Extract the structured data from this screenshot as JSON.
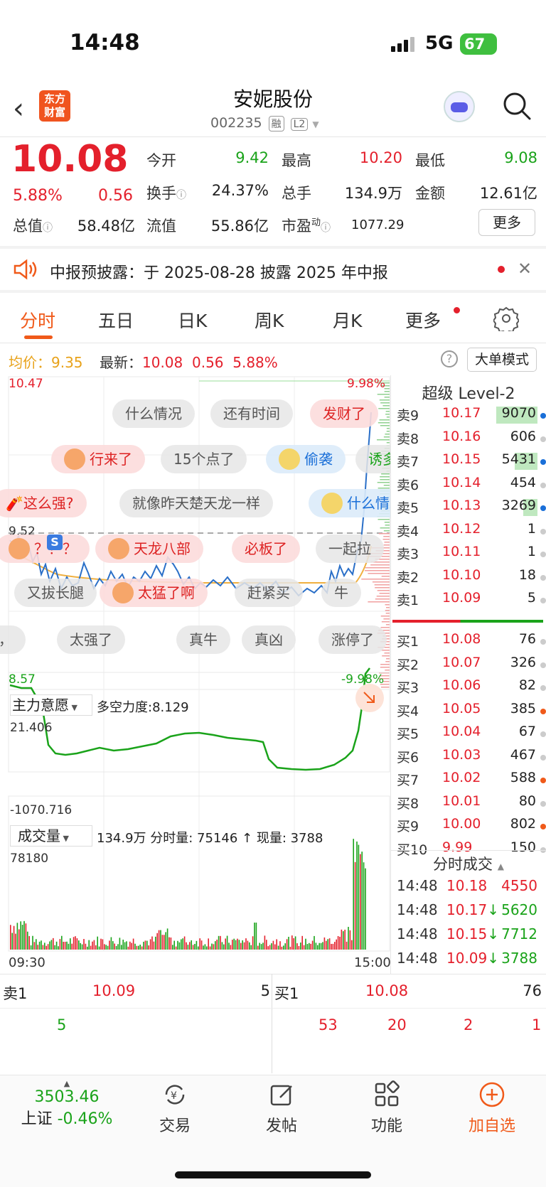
{
  "status_bar": {
    "time": "14:48",
    "network": "5G",
    "battery": "67"
  },
  "header": {
    "logo_text": "东方财富",
    "stock_name": "安妮股份",
    "stock_code": "002235",
    "tag_margin": "融",
    "tag_level": "L2"
  },
  "quote": {
    "price": "10.08",
    "change_pct": "5.88%",
    "change": "0.56",
    "open_label": "今开",
    "open": "9.42",
    "high_label": "最高",
    "high": "10.20",
    "low_label": "最低",
    "low": "9.08",
    "turnover_label": "换手",
    "turnover": "24.37%",
    "volume_label": "总手",
    "volume": "134.9万",
    "amount_label": "金额",
    "amount": "12.61亿",
    "mktcap_label": "总值",
    "mktcap": "58.48亿",
    "float_label": "流值",
    "float_cap": "55.86亿",
    "pe_label": "市盈",
    "pe_sup": "动",
    "pe": "1077.29",
    "more_label": "更多"
  },
  "notice": {
    "text": "中报预披露：于 2025-08-28 披露 2025 年中报"
  },
  "tabs": [
    "分时",
    "五日",
    "日K",
    "周K",
    "月K",
    "更多"
  ],
  "chart_info": {
    "avg_label": "均价：",
    "avg": "9.35",
    "newest_label": "最新：",
    "newest": "10.08",
    "newest_chg": "0.56",
    "newest_pct": "5.88%",
    "bigorder_label": "大单模式"
  },
  "chart_axes": {
    "y_max": "10.47",
    "y_min": "8.57",
    "pct_max": "9.98%",
    "pct_min": "-9.98%",
    "ref": "9.52",
    "t_start": "09:30",
    "t_end": "15:00",
    "main_label": "主力意愿",
    "main_metric": "多空力度:8.129",
    "main_max": "21.406",
    "main_min": "-1070.716",
    "vol_label": "成交量",
    "vol_info": "134.9万 分时量: 75146 ↑ 现量: 3788",
    "vol_max": "78180"
  },
  "danmu": [
    {
      "text": "什么情况",
      "style": "gray"
    },
    {
      "text": "还有时间",
      "style": "gray"
    },
    {
      "text": "发财了",
      "style": "pink"
    },
    {
      "text": "行来了",
      "style": "pink"
    },
    {
      "text": "15个点了",
      "style": "gray"
    },
    {
      "text": "偷袭",
      "style": "blue"
    },
    {
      "text": "诱多",
      "style": "gray"
    },
    {
      "text": "这么强?",
      "style": "pink"
    },
    {
      "text": "就像昨天楚天龙一样",
      "style": "gray"
    },
    {
      "text": "什么情况",
      "style": "blue"
    },
    {
      "text": "？？？",
      "style": "pink"
    },
    {
      "text": "天龙八部",
      "style": "pink"
    },
    {
      "text": "必板了",
      "style": "pink"
    },
    {
      "text": "一起拉",
      "style": "gray"
    },
    {
      "text": "又拔长腿",
      "style": "gray"
    },
    {
      "text": "太猛了啊",
      "style": "pink"
    },
    {
      "text": "赶紧买",
      "style": "gray"
    },
    {
      "text": "牛",
      "style": "gray"
    },
    {
      "text": "，",
      "style": "gray"
    },
    {
      "text": "太强了",
      "style": "gray"
    },
    {
      "text": "真牛",
      "style": "gray"
    },
    {
      "text": "真凶",
      "style": "gray"
    },
    {
      "text": "涨停了",
      "style": "gray"
    }
  ],
  "order_book": {
    "title": "超级 Level-2",
    "asks": [
      {
        "label": "卖9",
        "price": "10.17",
        "vol": "9070",
        "bar": 1.0,
        "dot": "#1a6fd8"
      },
      {
        "label": "卖8",
        "price": "10.16",
        "vol": "606",
        "bar": 0,
        "dot": "#ccc"
      },
      {
        "label": "卖7",
        "price": "10.15",
        "vol": "5431",
        "bar": 0.55,
        "dot": "#1a6fd8"
      },
      {
        "label": "卖6",
        "price": "10.14",
        "vol": "454",
        "bar": 0,
        "dot": "#ccc"
      },
      {
        "label": "卖5",
        "price": "10.13",
        "vol": "3269",
        "bar": 0.35,
        "dot": "#1a6fd8"
      },
      {
        "label": "卖4",
        "price": "10.12",
        "vol": "1",
        "bar": 0,
        "dot": "#ccc"
      },
      {
        "label": "卖3",
        "price": "10.11",
        "vol": "1",
        "bar": 0,
        "dot": "#ccc"
      },
      {
        "label": "卖2",
        "price": "10.10",
        "vol": "18",
        "bar": 0,
        "dot": "#ccc"
      },
      {
        "label": "卖1",
        "price": "10.09",
        "vol": "5",
        "bar": 0,
        "dot": "#ccc"
      }
    ],
    "bids": [
      {
        "label": "买1",
        "price": "10.08",
        "vol": "76",
        "dot": "#ccc"
      },
      {
        "label": "买2",
        "price": "10.07",
        "vol": "326",
        "dot": "#ccc"
      },
      {
        "label": "买3",
        "price": "10.06",
        "vol": "82",
        "dot": "#ccc"
      },
      {
        "label": "买4",
        "price": "10.05",
        "vol": "385",
        "dot": "#f05a1a"
      },
      {
        "label": "买5",
        "price": "10.04",
        "vol": "67",
        "dot": "#ccc"
      },
      {
        "label": "买6",
        "price": "10.03",
        "vol": "467",
        "dot": "#ccc"
      },
      {
        "label": "买7",
        "price": "10.02",
        "vol": "588",
        "dot": "#f05a1a"
      },
      {
        "label": "买8",
        "price": "10.01",
        "vol": "80",
        "dot": "#ccc"
      },
      {
        "label": "买9",
        "price": "10.00",
        "vol": "802",
        "dot": "#f05a1a"
      },
      {
        "label": "买10",
        "price": "9.99",
        "vol": "150",
        "dot": "#ccc"
      }
    ]
  },
  "ticks": {
    "title": "分时成交",
    "rows": [
      {
        "time": "14:48",
        "price": "10.18",
        "dir": "",
        "vol": "4550"
      },
      {
        "time": "14:48",
        "price": "10.17",
        "dir": "↓",
        "vol": "5620"
      },
      {
        "time": "14:48",
        "price": "10.15",
        "dir": "↓",
        "vol": "7712"
      },
      {
        "time": "14:48",
        "price": "10.09",
        "dir": "↓",
        "vol": "3788"
      }
    ]
  },
  "bid_ask_bar": {
    "ask_label": "卖1",
    "ask_price": "10.09",
    "ask_vol": "5",
    "bid_label": "买1",
    "bid_price": "10.08",
    "bid_vol": "76",
    "ask_orders": [
      "5"
    ],
    "bid_orders": [
      "53",
      "20",
      "2",
      "1"
    ]
  },
  "nav": {
    "index_value": "3503.46",
    "index_name": "上证",
    "index_chg": "-0.46%",
    "items": [
      "交易",
      "发帖",
      "功能",
      "加自选"
    ]
  }
}
